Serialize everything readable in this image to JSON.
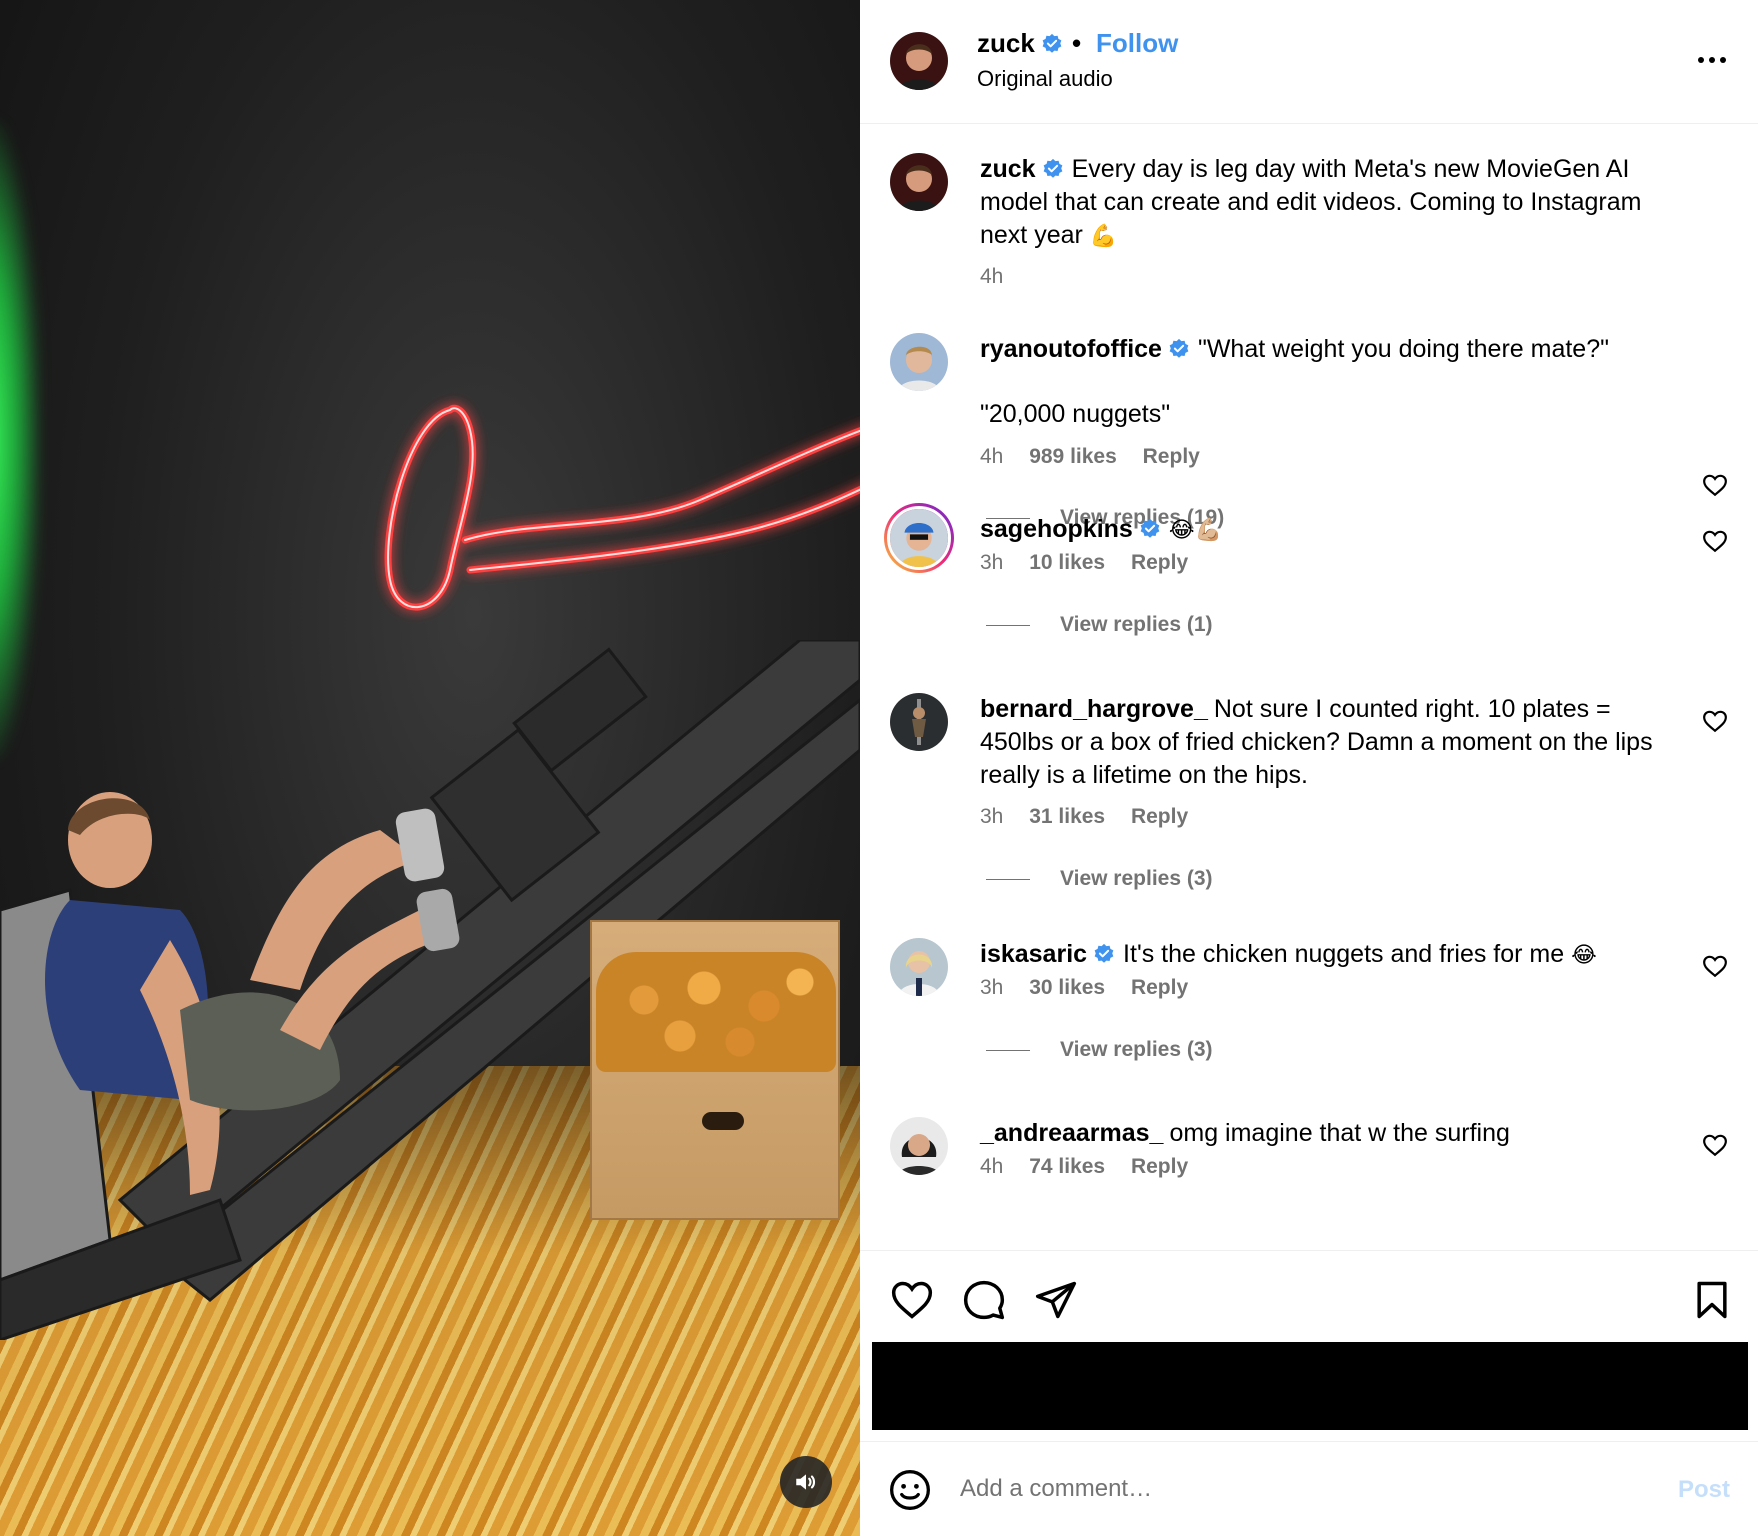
{
  "post": {
    "author": "zuck",
    "follow_label": "Follow",
    "separator": "•",
    "audio": "Original audio"
  },
  "caption": {
    "username": "zuck",
    "text": "Every day is leg day with Meta's new MovieGen AI model that can create and edit videos. Coming to Instagram next year",
    "emoji": "💪",
    "time": "4h"
  },
  "comments": [
    {
      "username": "ryanoutofoffice",
      "verified": true,
      "text": "\"What weight you doing there mate?\"",
      "text2": "\"20,000 nuggets\"",
      "time": "4h",
      "likes": "989 likes",
      "reply": "Reply",
      "view_replies": "View replies (19)"
    },
    {
      "username": "sagehopkins",
      "verified": true,
      "text": "😂💪🏼",
      "time": "3h",
      "likes": "10 likes",
      "reply": "Reply",
      "view_replies": "View replies (1)"
    },
    {
      "username": "bernard_hargrove_",
      "verified": false,
      "text": "Not sure I counted right. 10 plates = 450lbs or a box of fried chicken? Damn a moment on the lips really is a lifetime on the hips.",
      "time": "3h",
      "likes": "31 likes",
      "reply": "Reply",
      "view_replies": "View replies (3)"
    },
    {
      "username": "iskasaric",
      "verified": true,
      "text": "It's the chicken nuggets and fries for me",
      "emoji": "😂",
      "time": "3h",
      "likes": "30 likes",
      "reply": "Reply",
      "view_replies": "View replies (3)"
    },
    {
      "username": "_andreaarmas_",
      "verified": false,
      "text": "omg imagine that w the surfing",
      "time": "4h",
      "likes": "74 likes",
      "reply": "Reply"
    }
  ],
  "composer": {
    "placeholder": "Add a comment…",
    "post_label": "Post"
  },
  "icons": {
    "more": "more-options-icon",
    "like": "heart-icon",
    "comment": "comment-icon",
    "share": "paper-plane-icon",
    "save": "bookmark-icon",
    "emoji": "smiley-icon",
    "sound": "speaker-icon"
  },
  "colors": {
    "link": "#3f93ee",
    "muted": "#737373",
    "verified": "#3f93ee",
    "post_disabled": "#c5dffb"
  }
}
